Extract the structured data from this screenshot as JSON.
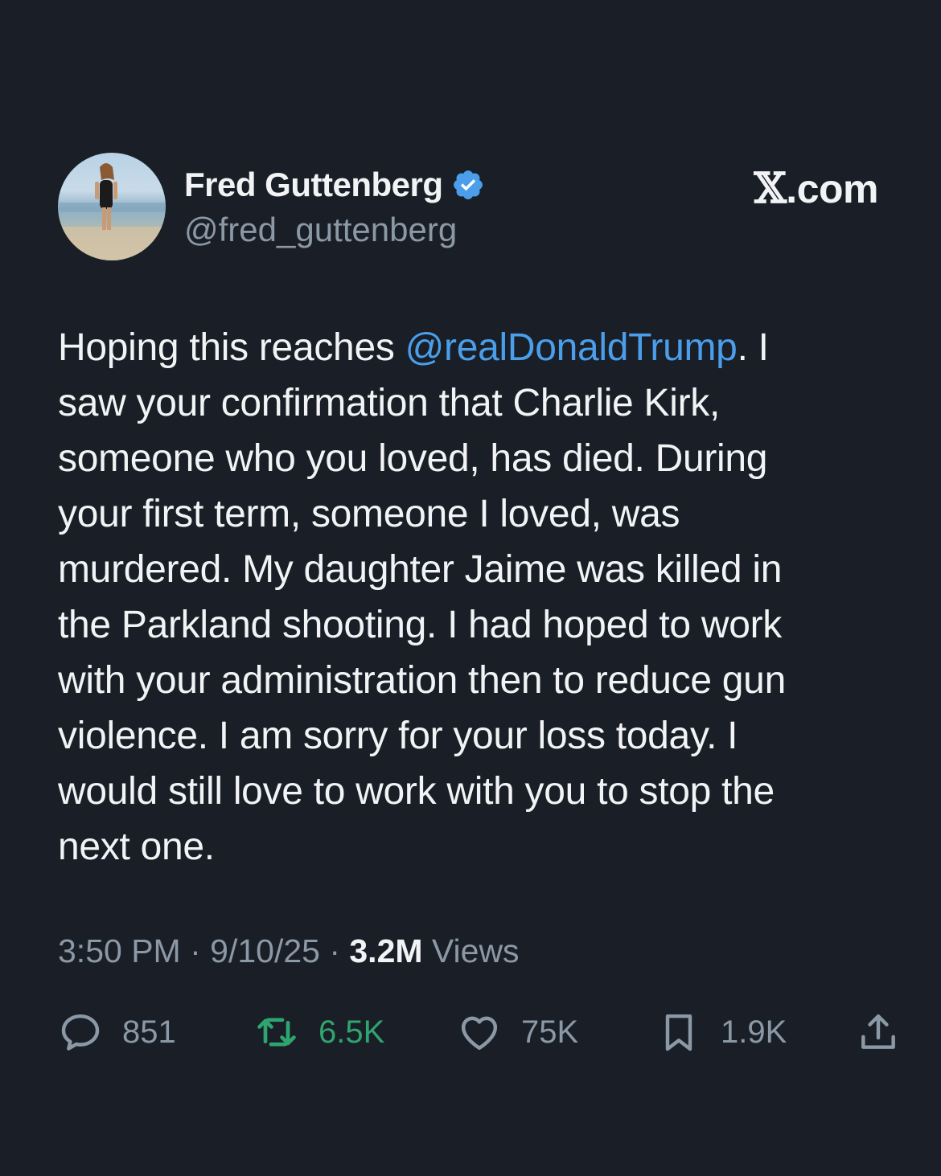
{
  "author": {
    "display_name": "Fred Guttenberg",
    "handle": "@fred_guttenberg",
    "verified": true,
    "verified_color": "#4a9eea"
  },
  "brand": {
    "x_glyph": "𝕏",
    "label": ".com"
  },
  "post": {
    "lines": [
      {
        "pre": "Hoping this reaches ",
        "mention": "@realDonaldTrump",
        "post": ".  I"
      },
      "saw your confirmation that Charlie Kirk,",
      "someone who you loved, has died.  During",
      "your first term, someone I loved, was",
      "murdered.  My daughter Jaime was killed in",
      "the Parkland shooting.  I had hoped to work",
      "with your administration then to reduce gun",
      "violence.  I am sorry for your loss today.  I",
      "would still love to work with you to stop the",
      "next one."
    ]
  },
  "meta": {
    "time": "3:50 PM",
    "separator": " · ",
    "date": "9/10/25",
    "views_count": "3.2M",
    "views_label": " Views"
  },
  "actions": {
    "replies": {
      "icon": "reply-icon",
      "count": "851"
    },
    "reposts": {
      "icon": "repost-icon",
      "count": "6.5K",
      "color": "#2ea56f"
    },
    "likes": {
      "icon": "heart-icon",
      "count": "75K"
    },
    "bookmarks": {
      "icon": "bookmark-icon",
      "count": "1.9K"
    },
    "share": {
      "icon": "share-icon"
    }
  },
  "colors": {
    "background": "#1a1f27",
    "primary_text": "#f1f3f4",
    "secondary_text": "#8b98a5",
    "link": "#4a9eea"
  }
}
